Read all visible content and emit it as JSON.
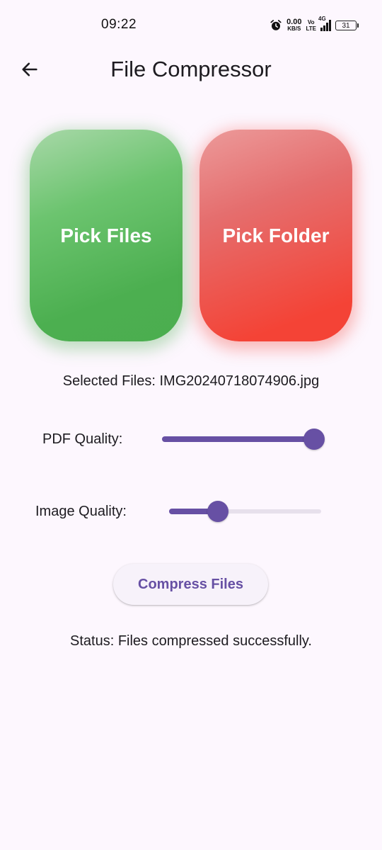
{
  "status_bar": {
    "time": "09:22",
    "net_speed_value": "0.00",
    "net_speed_unit": "KB/S",
    "volte_top": "Vo",
    "volte_bottom": "LTE",
    "network_type": "4G",
    "battery_level": "31",
    "icons": [
      "alarm-icon",
      "signal-icon",
      "battery-icon"
    ]
  },
  "app_bar": {
    "title": "File Compressor",
    "back_icon": "arrow-back-icon"
  },
  "pick_files": {
    "label": "Pick Files",
    "color": "#4caf50"
  },
  "pick_folder": {
    "label": "Pick Folder",
    "color": "#f44336"
  },
  "selected_files": "Selected Files: IMG20240718074906.jpg",
  "pdf_quality": {
    "label": "PDF Quality:",
    "value": 1.0
  },
  "image_quality": {
    "label": "Image Quality:",
    "value": 0.32
  },
  "compress_button": {
    "label": "Compress Files"
  },
  "status": "Status: Files compressed successfully.",
  "theme": {
    "background": "#fdf7fe",
    "accent": "#6750a4",
    "track_inactive": "#e7e0ec"
  }
}
